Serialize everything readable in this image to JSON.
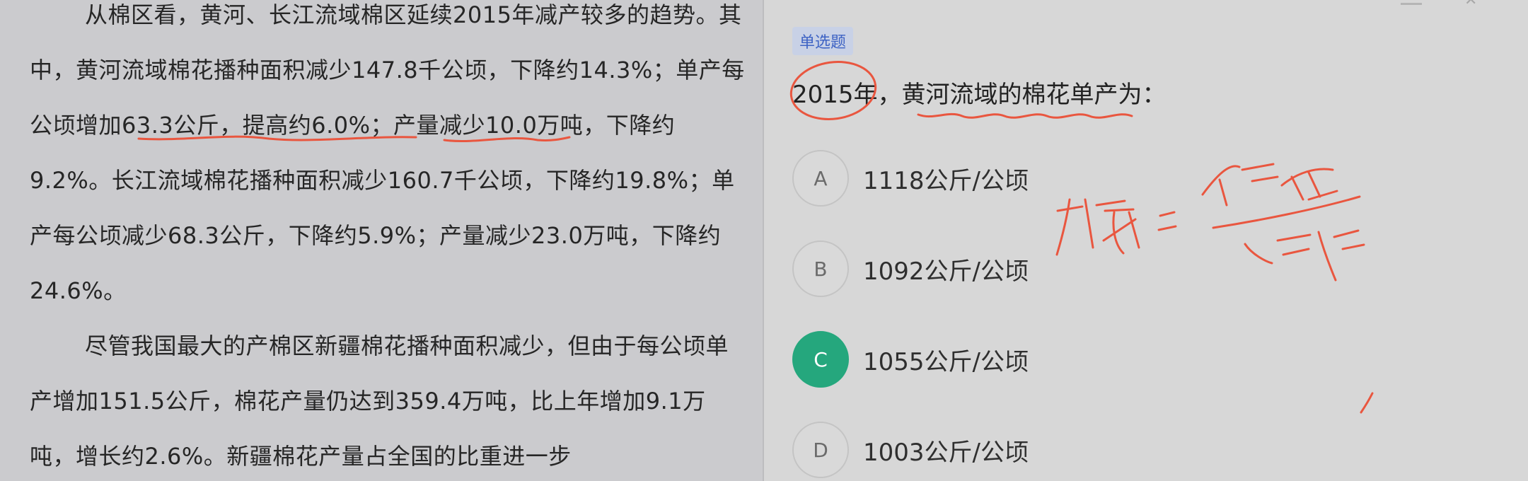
{
  "reading": {
    "p1": "从棉区看，黄河、长江流域棉区延续2015年减产较多的趋势。其中，黄河流域棉花播种面积减少147.8千公顷，下降约14.3%；单产每公顷增加63.3公斤，提高约6.0%；产量减少10.0万吨，下降约9.2%。长江流域棉花播种面积减少160.7千公顷，下降约19.8%；单产每公顷减少68.3公斤，下降约5.9%；产量减少23.0万吨，下降约24.6%。",
    "p2": "尽管我国最大的产棉区新疆棉花播种面积减少，但由于每公顷单产增加151.5公斤，棉花产量仍达到359.4万吨，比上年增加9.1万吨，增长约2.6%。新疆棉花产量占全国的比重进一步"
  },
  "question": {
    "type_label": "单选题",
    "stem": "2015年，黄河流域的棉花单产为：",
    "options": [
      {
        "letter": "A",
        "text": "1118公斤/公顷",
        "selected": false
      },
      {
        "letter": "B",
        "text": "1092公斤/公顷",
        "selected": false
      },
      {
        "letter": "C",
        "text": "1055公斤/公顷",
        "selected": true
      },
      {
        "letter": "D",
        "text": "1003公斤/公顷",
        "selected": false
      }
    ]
  },
  "colors": {
    "accent_green": "#25a77d",
    "annotation_red": "#e9563f",
    "tag_blue": "#3e63c4"
  }
}
